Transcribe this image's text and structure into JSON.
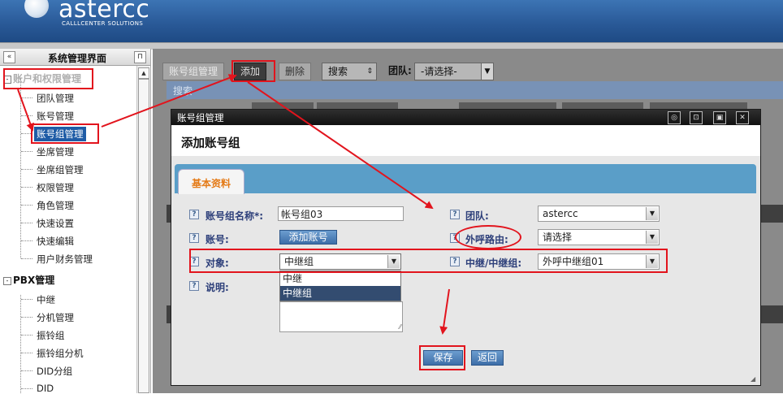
{
  "header": {
    "logo_text": "astercc",
    "logo_subtitle": "CALLLCENTER SOLUTIONS"
  },
  "sidebar": {
    "title": "系统管理界面",
    "collapse_glyph": "«",
    "pin_glyph": "⊓",
    "groups": [
      {
        "label": "账户和权限管理",
        "toggle": "-",
        "items": [
          "团队管理",
          "账号管理",
          "账号组管理",
          "坐席管理",
          "坐席组管理",
          "权限管理",
          "角色管理",
          "快速设置",
          "快速编辑",
          "用户财务管理"
        ]
      },
      {
        "label": "PBX管理",
        "toggle": "-",
        "items": [
          "中继",
          "分机管理",
          "振铃组",
          "振铃组分机",
          "DID分组",
          "DID"
        ]
      }
    ],
    "selected_item": "账号组管理"
  },
  "toolbar": {
    "tab_label": "账号组管理",
    "add_label": "添加",
    "delete_label": "删除",
    "search_select": "搜索",
    "team_label": "团队:",
    "team_select": "-请选择-"
  },
  "search_bar": {
    "label": "搜索"
  },
  "modal": {
    "window_title": "账号组管理",
    "heading": "添加账号组",
    "tab": "基本资料",
    "controls": [
      "◎",
      "⊡",
      "▣",
      "✕"
    ],
    "help_glyph": "?",
    "fields": {
      "name_label": "账号组名称*:",
      "name_value": "帐号组03",
      "team_label": "团队:",
      "team_value": "astercc",
      "account_label": "账号:",
      "add_account_button": "添加账号",
      "route_label": "外呼路由:",
      "route_value": "请选择",
      "target_label": "对象:",
      "target_value": "中继组",
      "target_options": [
        "中继",
        "中继组"
      ],
      "trunk_label": "中继/中继组:",
      "trunk_value": "外呼中继组01",
      "desc_label": "说明:"
    },
    "save_button": "保存",
    "back_button": "返回"
  },
  "colors": {
    "annotation_red": "#e2141d",
    "header_blue": "#2a5a98",
    "selected_blue": "#1f5ca6",
    "tab_orange": "#e47a16",
    "label_navy": "#2d3f7a"
  }
}
